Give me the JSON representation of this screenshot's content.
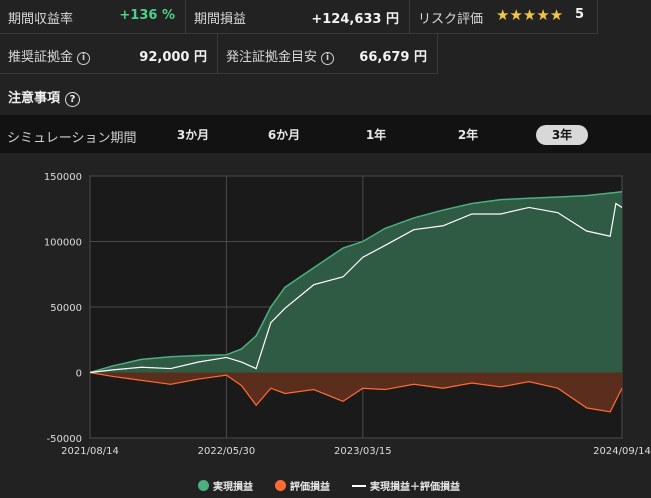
{
  "stats": {
    "return_label": "期間収益率",
    "return_value": "+136 %",
    "pl_label": "期間損益",
    "pl_value": "+124,633 円",
    "risk_label": "リスク評価",
    "risk_stars": "★★★★★",
    "risk_value": "5",
    "margin_label": "推奨証拠金",
    "margin_value": "92,000 円",
    "order_label": "発注証拠金目安",
    "order_value": "66,679 円"
  },
  "notice": {
    "label": "注意事項"
  },
  "simulation": {
    "label": "シミュレーション期間",
    "tabs": [
      "3か月",
      "6か月",
      "1年",
      "2年",
      "3年"
    ],
    "active": "3年"
  },
  "chart_data": {
    "type": "area",
    "x_ticks": [
      "2021/08/14",
      "2022/05/30",
      "2023/03/15",
      "2024/09/14"
    ],
    "y_ticks": [
      150000,
      100000,
      50000,
      0,
      -50000
    ],
    "ylim": [
      -50000,
      150000
    ],
    "grid": true,
    "legend_position": "bottom",
    "series": [
      {
        "name": "実現損益",
        "color": "#4caf80",
        "points": [
          [
            "2021/08/14",
            0
          ],
          [
            "2021/10/01",
            5000
          ],
          [
            "2021/12/01",
            10000
          ],
          [
            "2022/02/01",
            12000
          ],
          [
            "2022/04/01",
            13000
          ],
          [
            "2022/05/30",
            13500
          ],
          [
            "2022/07/01",
            18000
          ],
          [
            "2022/08/01",
            28000
          ],
          [
            "2022/09/01",
            50000
          ],
          [
            "2022/10/01",
            65000
          ],
          [
            "2022/12/01",
            80000
          ],
          [
            "2023/02/01",
            95000
          ],
          [
            "2023/03/15",
            100000
          ],
          [
            "2023/05/01",
            110000
          ],
          [
            "2023/07/01",
            118000
          ],
          [
            "2023/09/01",
            124000
          ],
          [
            "2023/11/01",
            129000
          ],
          [
            "2024/01/01",
            132000
          ],
          [
            "2024/03/01",
            133000
          ],
          [
            "2024/05/01",
            134000
          ],
          [
            "2024/07/01",
            135000
          ],
          [
            "2024/09/14",
            138000
          ]
        ]
      },
      {
        "name": "評価損益",
        "color": "#ff6b35",
        "points": [
          [
            "2021/08/14",
            0
          ],
          [
            "2021/10/01",
            -3000
          ],
          [
            "2021/12/01",
            -6000
          ],
          [
            "2022/02/01",
            -9000
          ],
          [
            "2022/04/01",
            -5000
          ],
          [
            "2022/05/30",
            -2000
          ],
          [
            "2022/07/01",
            -10000
          ],
          [
            "2022/08/01",
            -25000
          ],
          [
            "2022/09/01",
            -12000
          ],
          [
            "2022/10/01",
            -16000
          ],
          [
            "2022/12/01",
            -13000
          ],
          [
            "2023/02/01",
            -22000
          ],
          [
            "2023/03/15",
            -12000
          ],
          [
            "2023/05/01",
            -13000
          ],
          [
            "2023/07/01",
            -9000
          ],
          [
            "2023/09/01",
            -12000
          ],
          [
            "2023/11/01",
            -8000
          ],
          [
            "2024/01/01",
            -11000
          ],
          [
            "2024/03/01",
            -7000
          ],
          [
            "2024/05/01",
            -12000
          ],
          [
            "2024/07/01",
            -27000
          ],
          [
            "2024/08/20",
            -30000
          ],
          [
            "2024/09/14",
            -12000
          ]
        ]
      },
      {
        "name": "実現損益＋評価損益",
        "color": "#ffffff",
        "points": [
          [
            "2021/08/14",
            0
          ],
          [
            "2021/10/01",
            2000
          ],
          [
            "2021/12/01",
            4000
          ],
          [
            "2022/02/01",
            3000
          ],
          [
            "2022/04/01",
            8000
          ],
          [
            "2022/05/30",
            11500
          ],
          [
            "2022/07/01",
            8000
          ],
          [
            "2022/08/01",
            3000
          ],
          [
            "2022/09/01",
            38000
          ],
          [
            "2022/10/01",
            49000
          ],
          [
            "2022/12/01",
            67000
          ],
          [
            "2023/02/01",
            73000
          ],
          [
            "2023/03/15",
            88000
          ],
          [
            "2023/05/01",
            97000
          ],
          [
            "2023/07/01",
            109000
          ],
          [
            "2023/09/01",
            112000
          ],
          [
            "2023/11/01",
            121000
          ],
          [
            "2024/01/01",
            121000
          ],
          [
            "2024/03/01",
            126000
          ],
          [
            "2024/05/01",
            122000
          ],
          [
            "2024/07/01",
            108000
          ],
          [
            "2024/08/20",
            104000
          ],
          [
            "2024/09/01",
            129000
          ],
          [
            "2024/09/14",
            126000
          ]
        ]
      }
    ]
  }
}
